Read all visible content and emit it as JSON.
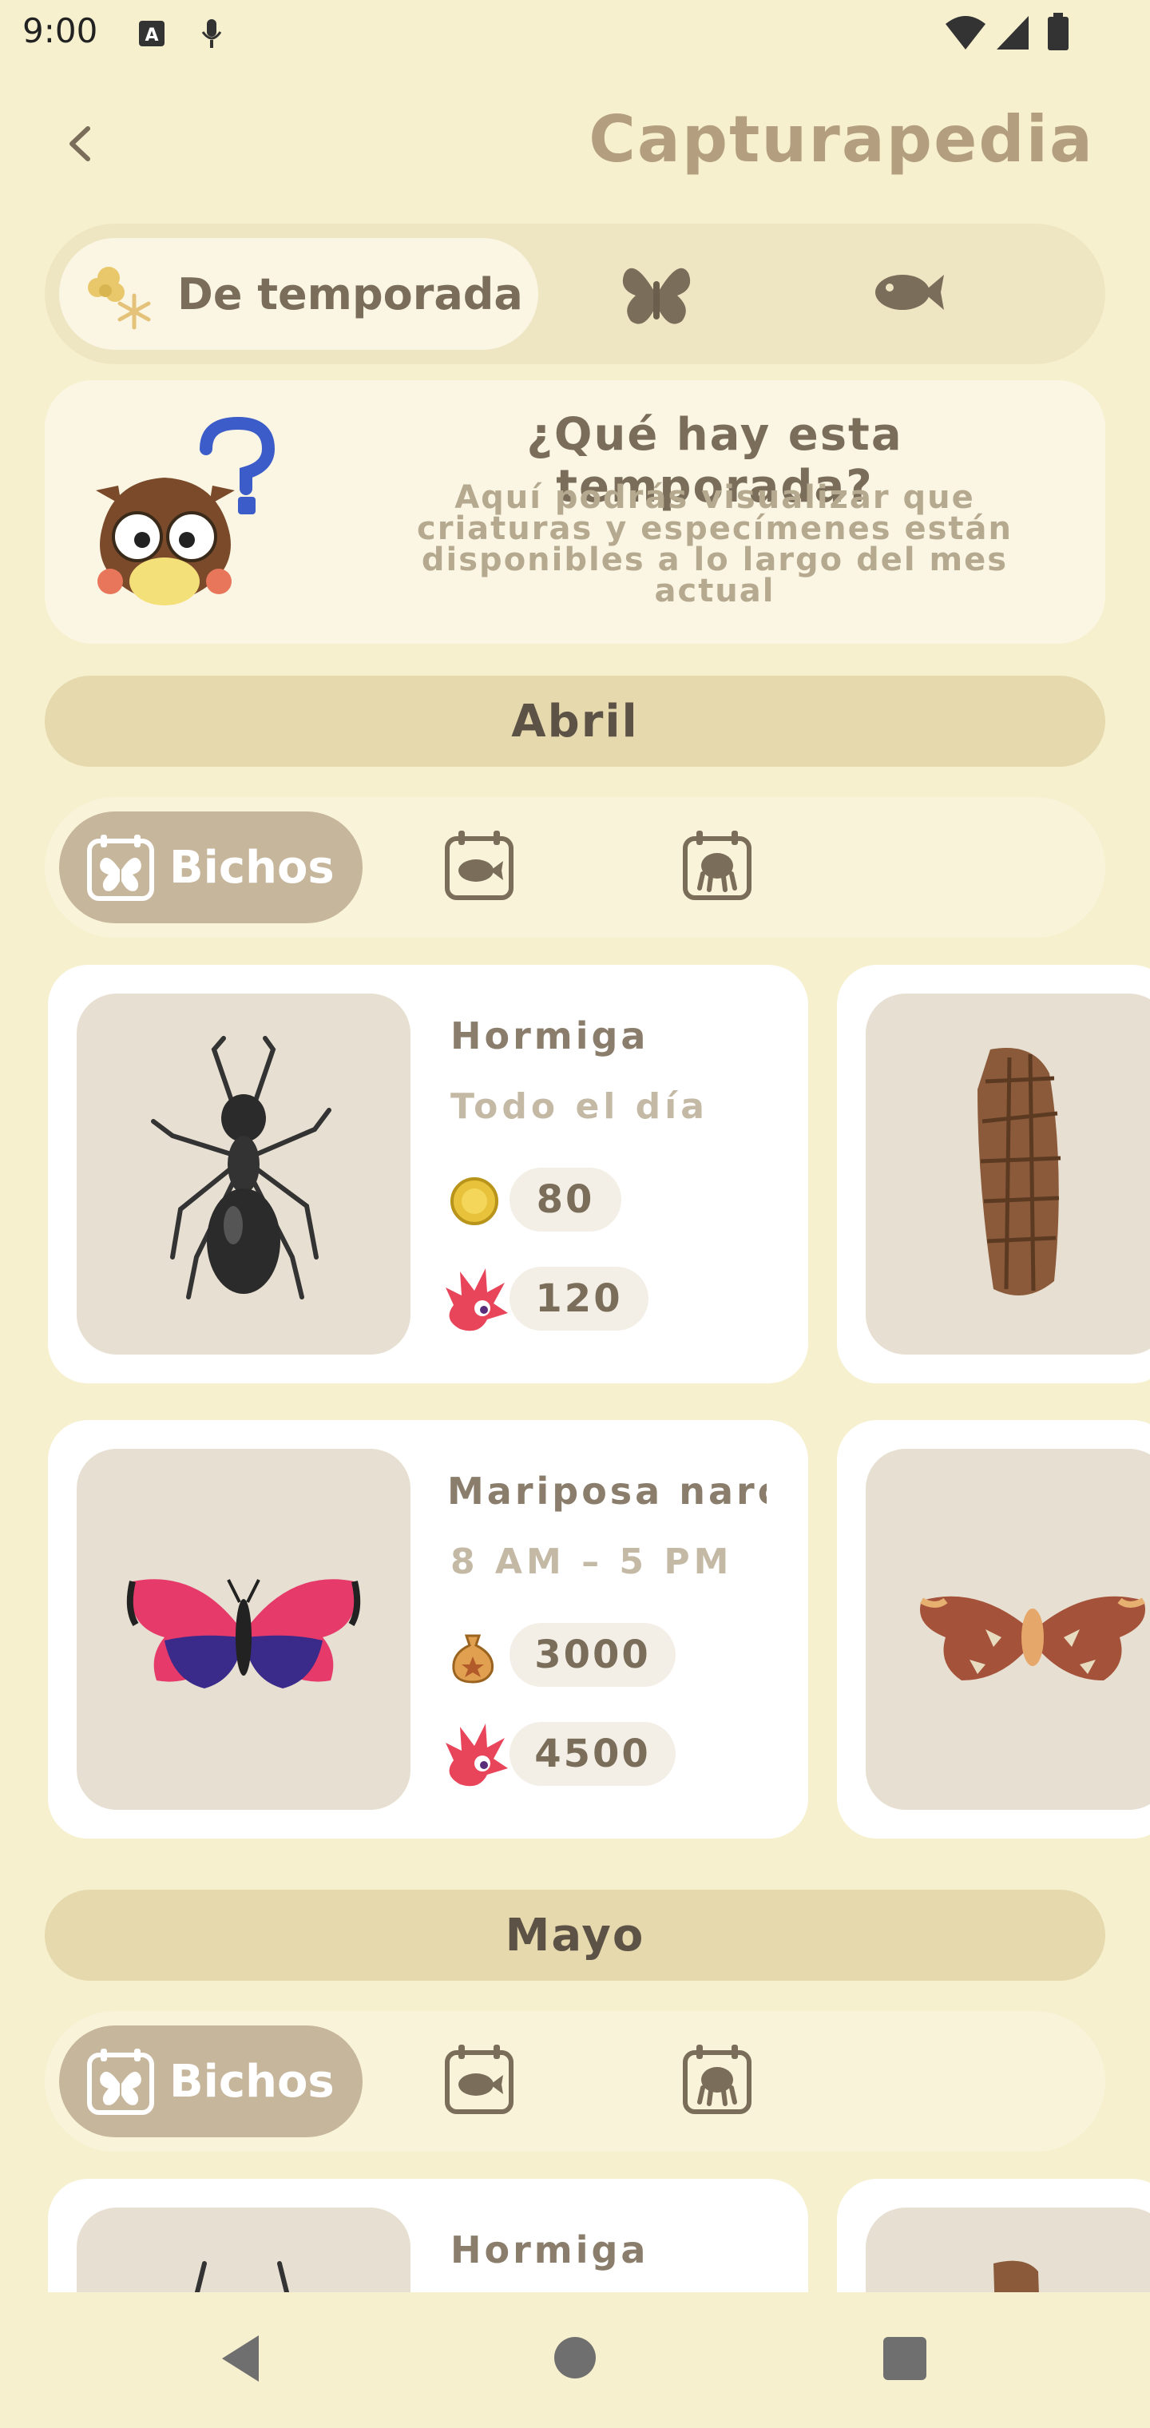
{
  "status": {
    "time": "9:00"
  },
  "header": {
    "title": "Capturapedia"
  },
  "top_tabs": {
    "active_label": "De temporada",
    "items": [
      "de-temporada",
      "bugs",
      "fish"
    ]
  },
  "info": {
    "title": "¿Qué hay esta temporada?",
    "description": "Aquí podrás visualizar que criaturas y especímenes están disponibles a lo largo del mes actual"
  },
  "months": [
    {
      "name": "Abril",
      "sub_tab_label": "Bichos",
      "cards": [
        {
          "name": "Hormiga",
          "time": "Todo el día",
          "price": "80",
          "cj_price": "120",
          "currency": "bell-coin"
        },
        {
          "name": "Mariposa narci",
          "time": "8 AM – 5 PM",
          "price": "3000",
          "cj_price": "4500",
          "currency": "bell-bag"
        }
      ]
    },
    {
      "name": "Mayo",
      "sub_tab_label": "Bichos",
      "cards": [
        {
          "name": "Hormiga"
        }
      ]
    }
  ],
  "colors": {
    "background": "#f6f0cf",
    "title": "#b39f7f",
    "month_bar": "#e5d9ad"
  }
}
